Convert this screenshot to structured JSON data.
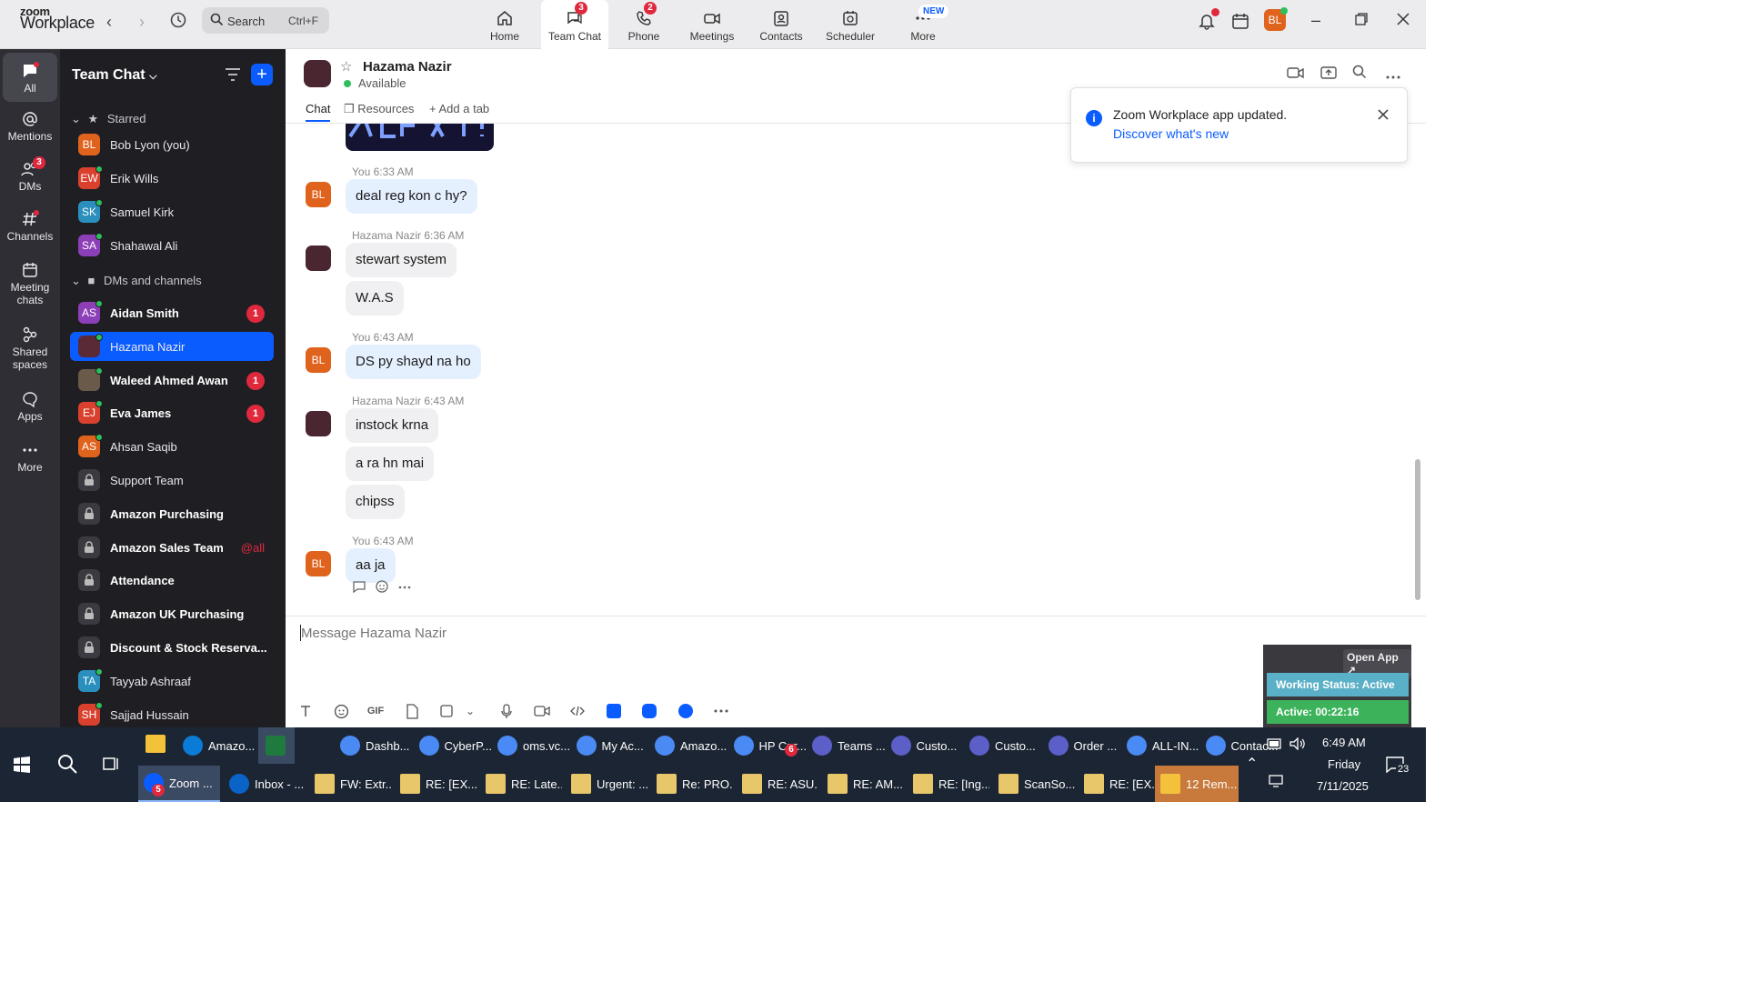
{
  "app": {
    "logo_top": "zoom",
    "logo_bottom": "Workplace"
  },
  "search": {
    "label": "Search",
    "shortcut": "Ctrl+F"
  },
  "nav": {
    "tabs": [
      {
        "label": "Home",
        "badge": ""
      },
      {
        "label": "Team Chat",
        "badge": "3"
      },
      {
        "label": "Phone",
        "badge": "2"
      },
      {
        "label": "Meetings",
        "badge": ""
      },
      {
        "label": "Contacts",
        "badge": ""
      },
      {
        "label": "Scheduler",
        "badge": ""
      },
      {
        "label": "More",
        "badge": "NEW"
      }
    ],
    "avatar_initials": "BL"
  },
  "rail": {
    "items": [
      {
        "label": "All",
        "badge": ""
      },
      {
        "label": "Mentions",
        "badge": ""
      },
      {
        "label": "DMs",
        "badge": "3"
      },
      {
        "label": "Channels",
        "badge": ""
      },
      {
        "label": "Meeting chats",
        "badge": ""
      },
      {
        "label": "Shared spaces",
        "badge": ""
      },
      {
        "label": "Apps",
        "badge": ""
      },
      {
        "label": "More",
        "badge": ""
      }
    ]
  },
  "sidebar": {
    "title": "Team Chat",
    "starred_label": "Starred",
    "dms_label": "DMs and channels",
    "starred": [
      {
        "initials": "BL",
        "name": "Bob Lyon (you)",
        "color": "#e0631d"
      },
      {
        "initials": "EW",
        "name": "Erik Wills",
        "color": "#d9412e"
      },
      {
        "initials": "SK",
        "name": "Samuel Kirk",
        "color": "#2a8fbd"
      },
      {
        "initials": "SA",
        "name": "Shahawal Ali",
        "color": "#8d3fb8"
      }
    ],
    "items": [
      {
        "initials": "AS",
        "name": "Aidan Smith",
        "count": "1",
        "color": "#8d3fb8",
        "bold": true
      },
      {
        "initials": "",
        "name": "Hazama Nazir",
        "count": "",
        "color": "#5a2a36",
        "bold": false
      },
      {
        "initials": "",
        "name": "Waleed Ahmed Awan",
        "count": "1",
        "color": "#6a5a4a",
        "bold": true
      },
      {
        "initials": "EJ",
        "name": "Eva James",
        "count": "1",
        "color": "#d9412e",
        "bold": true
      },
      {
        "initials": "AS",
        "name": "Ahsan Saqib",
        "count": "",
        "color": "#e0631d",
        "bold": false
      },
      {
        "initials": "",
        "name": "Support Team",
        "count": "",
        "color": "",
        "bold": false
      },
      {
        "initials": "",
        "name": "Amazon Purchasing",
        "count": "",
        "color": "",
        "bold": true
      },
      {
        "initials": "",
        "name": "Amazon Sales Team",
        "count": "@all",
        "color": "",
        "bold": true
      },
      {
        "initials": "",
        "name": "Attendance",
        "count": "",
        "color": "",
        "bold": true
      },
      {
        "initials": "",
        "name": "Amazon UK Purchasing",
        "count": "",
        "color": "",
        "bold": true
      },
      {
        "initials": "",
        "name": "Discount & Stock Reserva...",
        "count": "",
        "color": "",
        "bold": true
      },
      {
        "initials": "TA",
        "name": "Tayyab Ashraaf",
        "count": "",
        "color": "#2a8fbd",
        "bold": false
      },
      {
        "initials": "SH",
        "name": "Sajjad Hussain",
        "count": "",
        "color": "#d9412e",
        "bold": false
      }
    ]
  },
  "chat": {
    "contact_name": "Hazama Nazir",
    "status": "Available",
    "tabs": {
      "chat": "Chat",
      "resources": "Resources",
      "add": "Add a tab"
    },
    "messages": [
      {
        "sender": "You",
        "time": "6:33 AM",
        "me": true,
        "lines": [
          "deal reg kon c hy?"
        ]
      },
      {
        "sender": "Hazama Nazir",
        "time": "6:36 AM",
        "me": false,
        "lines": [
          "stewart system",
          "W.A.S"
        ]
      },
      {
        "sender": "You",
        "time": "6:43 AM",
        "me": true,
        "lines": [
          "DS py shayd na ho"
        ]
      },
      {
        "sender": "Hazama Nazir",
        "time": "6:43 AM",
        "me": false,
        "lines": [
          "instock krna",
          "a ra hn mai",
          "chipss"
        ]
      },
      {
        "sender": "You",
        "time": "6:43 AM",
        "me": true,
        "lines": [
          "aa ja"
        ]
      }
    ],
    "composer_placeholder": "Message Hazama Nazir"
  },
  "toast": {
    "title": "Zoom Workplace app updated.",
    "link": "Discover what's new"
  },
  "widget": {
    "open_app": "Open App ↗",
    "working_status": "Working Status: Active",
    "active_time": "Active: 00:22:16"
  },
  "taskbar": {
    "row1": [
      "Amazo...",
      "",
      "Dashb...",
      "CyberP...",
      "oms.vc...",
      "My Ac...",
      "Amazo...",
      "HP Cur...",
      "Teams ...",
      "Custo...",
      "Custo...",
      "Order ...",
      "ALL-IN...",
      "Contac..."
    ],
    "row2": [
      "Zoom ...",
      "Inbox - ...",
      "FW: Extr...",
      "RE: [EX...",
      "RE: Late...",
      "Urgent: ...",
      "Re: PRO...",
      "RE: ASU...",
      "RE: AM...",
      "RE: [Ing...",
      "ScanSo...",
      "RE: [EX...",
      "12 Rem..."
    ],
    "time": "6:49 AM",
    "day": "Friday",
    "date": "7/11/2025",
    "notif_count": "23",
    "teams_badge": "6",
    "zoom_badge": "5"
  },
  "colors": {
    "accent": "#0b5cff",
    "badge": "#e0283d",
    "me_bubble": "#e5f0ff"
  }
}
